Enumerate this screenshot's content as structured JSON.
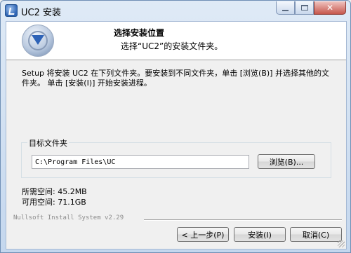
{
  "window": {
    "title": "UC2 安装"
  },
  "header": {
    "title": "选择安装位置",
    "subtitle": "选择“UC2”的安装文件夹。"
  },
  "intro": {
    "text": "Setup 将安装 UC2 在下列文件夹。要安装到不同文件夹，单击 [浏览(B)] 并选择其他的文件夹。 单击 [安装(I)] 开始安装进程。"
  },
  "destination": {
    "group_label": "目标文件夹",
    "path_value": "C:\\Program Files\\UC",
    "browse_label": "浏览(B)..."
  },
  "space": {
    "required": "所需空间: 45.2MB",
    "available": "可用空间: 71.1GB"
  },
  "branding": {
    "text": "Nullsoft Install System v2.29"
  },
  "buttons": {
    "back": "< 上一步(P)",
    "install": "安装(I)",
    "cancel": "取消(C)"
  },
  "colors": {
    "titlebar": "#c4d7ee",
    "close_button": "#c6574c",
    "header_background": "#ffffff"
  }
}
